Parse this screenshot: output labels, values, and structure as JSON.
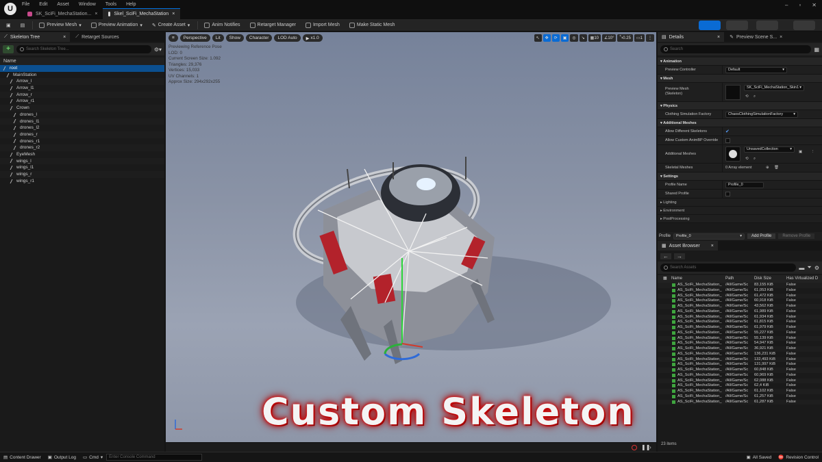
{
  "window": {
    "menu": [
      "File",
      "Edit",
      "Asset",
      "Window",
      "Tools",
      "Help"
    ],
    "tabs": [
      {
        "label": "SK_SciFi_MechaStation..."
      },
      {
        "label": "Skel_SciFi_MechaStation"
      }
    ]
  },
  "toolbar": {
    "items": [
      "Preview Mesh",
      "Preview Animation",
      "Create Asset",
      "Anim Notifies",
      "Retarget Manager",
      "Import Mesh",
      "Make Static Mesh"
    ]
  },
  "left_panel": {
    "tabs": [
      "Skeleton Tree",
      "Retarget Sources"
    ],
    "search_placeholder": "Search Skeleton Tree...",
    "column_header": "Name",
    "bones": [
      {
        "name": "root",
        "depth": 0
      },
      {
        "name": "MainStation",
        "depth": 1
      },
      {
        "name": "Arrow_l",
        "depth": 2
      },
      {
        "name": "Arrow_l1",
        "depth": 2
      },
      {
        "name": "Arrow_r",
        "depth": 2
      },
      {
        "name": "Arrow_r1",
        "depth": 2
      },
      {
        "name": "Crown",
        "depth": 2
      },
      {
        "name": "drones_l",
        "depth": 3
      },
      {
        "name": "drones_l1",
        "depth": 3
      },
      {
        "name": "drones_l2",
        "depth": 3
      },
      {
        "name": "drones_r",
        "depth": 3
      },
      {
        "name": "drones_r1",
        "depth": 3
      },
      {
        "name": "drones_r2",
        "depth": 3
      },
      {
        "name": "EyeMesh",
        "depth": 2
      },
      {
        "name": "wings_l",
        "depth": 2
      },
      {
        "name": "wings_l1",
        "depth": 2
      },
      {
        "name": "wings_r",
        "depth": 2
      },
      {
        "name": "wings_r1",
        "depth": 2
      }
    ]
  },
  "viewport": {
    "buttons": [
      "Perspective",
      "Lit",
      "Show",
      "Character",
      "LOD Auto",
      "x1.0"
    ],
    "right_controls": [
      "10",
      "10°",
      "0.25",
      "1"
    ],
    "stats": [
      "Previewing Reference Pose",
      "LOD: 0",
      "Current Screen Size: 1.092",
      "Triangles: 29,376",
      "Vertices: 15,033",
      "UV Channels: 1",
      "Approx Size: 294x292x255"
    ],
    "overlay_title": "Custom Skeleton"
  },
  "details": {
    "tabs": [
      "Details",
      "Preview Scene S..."
    ],
    "search_placeholder": "Search",
    "sections": {
      "animation": "Animation",
      "mesh": "Mesh",
      "physics": "Physics",
      "additional_meshes": "Additional Meshes",
      "settings": "Settings",
      "lighting": "Lighting",
      "environment": "Environment",
      "postprocessing": "PostProcessing"
    },
    "rows": {
      "preview_controller": {
        "label": "Preview Controller",
        "value": "Default"
      },
      "preview_mesh": {
        "label": "Preview Mesh",
        "sub": "(Skeleton)",
        "value": "SK_SciFi_MechaStation_Skin1"
      },
      "clothing": {
        "label": "Clothing Simulation Factory",
        "value": "ChaosClothingSimulationFactory"
      },
      "allow_diff": {
        "label": "Allow Different Skeletons"
      },
      "allow_custom": {
        "label": "Allow Custom AnimBP Override"
      },
      "additional_meshes": {
        "label": "Additional Meshes",
        "value": "UnsavedCollection"
      },
      "skeletal_meshes": {
        "label": "Skeletal Meshes",
        "value": "0 Array element"
      },
      "profile_name": {
        "label": "Profile Name",
        "value": "Profile_0"
      },
      "shared_profile": {
        "label": "Shared Profile"
      }
    },
    "profile_label": "Profile",
    "profile_value": "Profile_0",
    "add_profile": "Add Profile",
    "remove_profile": "Remove Profile"
  },
  "asset_browser": {
    "tab": "Asset Browser",
    "search_placeholder": "Search Assets",
    "columns": [
      "Name",
      "Path",
      "Disk Size",
      "Has Virtualized D"
    ],
    "rows": [
      {
        "name": "AS_SciFi_MechaStation_",
        "path": "/All/Game/Sc",
        "size": "83,155 KiB",
        "virt": "False"
      },
      {
        "name": "AS_SciFi_MechaStation_",
        "path": "/All/Game/Sc",
        "size": "61,053 KiB",
        "virt": "False"
      },
      {
        "name": "AS_SciFi_MechaStation_",
        "path": "/All/Game/Sc",
        "size": "61,472 KiB",
        "virt": "False"
      },
      {
        "name": "AS_SciFi_MechaStation_",
        "path": "/All/Game/Sc",
        "size": "60,918 KiB",
        "virt": "False"
      },
      {
        "name": "AS_SciFi_MechaStation_",
        "path": "/All/Game/Sc",
        "size": "43,562 KiB",
        "virt": "False"
      },
      {
        "name": "AS_SciFi_MechaStation_",
        "path": "/All/Game/Sc",
        "size": "61,989 KiB",
        "virt": "False"
      },
      {
        "name": "AS_SciFi_MechaStation_",
        "path": "/All/Game/Sc",
        "size": "61,934 KiB",
        "virt": "False"
      },
      {
        "name": "AS_SciFi_MechaStation_",
        "path": "/All/Game/Sc",
        "size": "61,815 KiB",
        "virt": "False"
      },
      {
        "name": "AS_SciFi_MechaStation_",
        "path": "/All/Game/Sc",
        "size": "61,979 KiB",
        "virt": "False"
      },
      {
        "name": "AS_SciFi_MechaStation_",
        "path": "/All/Game/Sc",
        "size": "55,227 KiB",
        "virt": "False"
      },
      {
        "name": "AS_SciFi_MechaStation_",
        "path": "/All/Game/Sc",
        "size": "55,139 KiB",
        "virt": "False"
      },
      {
        "name": "AS_SciFi_MechaStation_",
        "path": "/All/Game/Sc",
        "size": "54,947 KiB",
        "virt": "False"
      },
      {
        "name": "AS_SciFi_MechaStation_",
        "path": "/All/Game/Sc",
        "size": "36,921 KiB",
        "virt": "False"
      },
      {
        "name": "AS_SciFi_MechaStation_",
        "path": "/All/Game/Sc",
        "size": "136,231 KiB",
        "virt": "False"
      },
      {
        "name": "AS_SciFi_MechaStation_",
        "path": "/All/Game/Sc",
        "size": "132,493 KiB",
        "virt": "False"
      },
      {
        "name": "AS_SciFi_MechaStation_",
        "path": "/All/Game/Sc",
        "size": "131,997 KiB",
        "virt": "False"
      },
      {
        "name": "AS_SciFi_MechaStation_",
        "path": "/All/Game/Sc",
        "size": "60,848 KiB",
        "virt": "False"
      },
      {
        "name": "AS_SciFi_MechaStation_",
        "path": "/All/Game/Sc",
        "size": "60,969 KiB",
        "virt": "False"
      },
      {
        "name": "AS_SciFi_MechaStation_",
        "path": "/All/Game/Sc",
        "size": "62,088 KiB",
        "virt": "False"
      },
      {
        "name": "AS_SciFi_MechaStation_",
        "path": "/All/Game/Sc",
        "size": "62,4 KiB",
        "virt": "False"
      },
      {
        "name": "AS_SciFi_MechaStation_",
        "path": "/All/Game/Sc",
        "size": "61,102 KiB",
        "virt": "False"
      },
      {
        "name": "AS_SciFi_MechaStation_",
        "path": "/All/Game/Sc",
        "size": "61,257 KiB",
        "virt": "False"
      },
      {
        "name": "AS_SciFi_MechaStation_",
        "path": "/All/Game/Sc",
        "size": "61,287 KiB",
        "virt": "False"
      }
    ],
    "count": "23 items"
  },
  "statusbar": {
    "content_drawer": "Content Drawer",
    "output_log": "Output Log",
    "cmd": "Cmd",
    "console_placeholder": "Enter Console Command",
    "all_saved": "All Saved",
    "revision_control": "Revision Control"
  }
}
